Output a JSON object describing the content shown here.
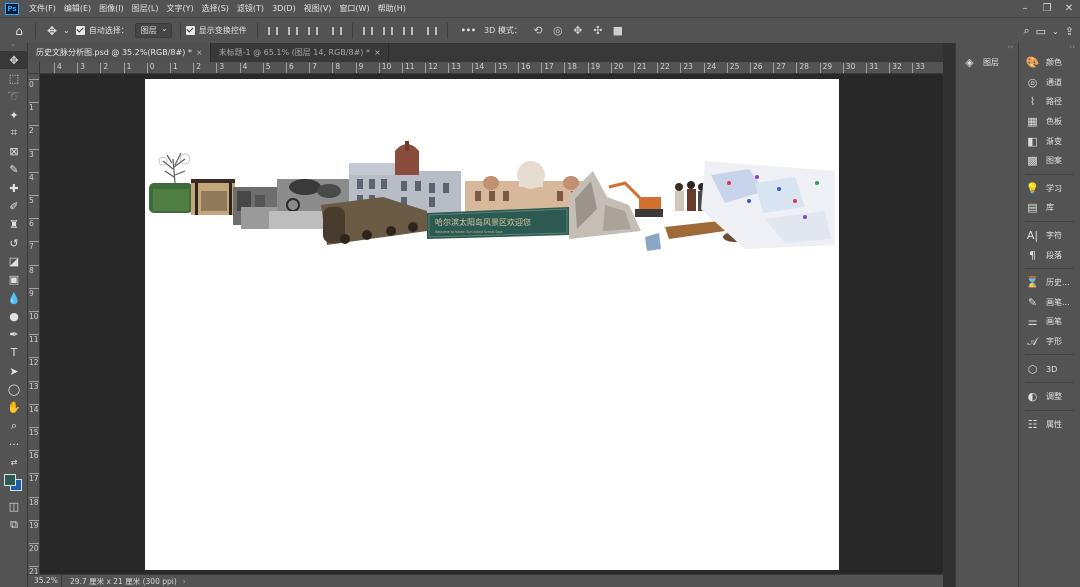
{
  "app": {
    "logo": "Ps",
    "menu": [
      "文件(F)",
      "编辑(E)",
      "图像(I)",
      "图层(L)",
      "文字(Y)",
      "选择(S)",
      "滤镜(T)",
      "3D(D)",
      "视图(V)",
      "窗口(W)",
      "帮助(H)"
    ],
    "window_controls": [
      "minimize-icon",
      "restore-icon",
      "close-icon"
    ]
  },
  "options_bar": {
    "auto_select_label": "自动选择：",
    "auto_select_value": "图层",
    "auto_select_checked": true,
    "transform_label": "显示变换控件",
    "transform_checked": true,
    "more_label": "•••",
    "mode_3d_label": "3D 模式："
  },
  "tabs": [
    {
      "label": "历史文脉分析图.psd @ 35.2%(RGB/8#) *",
      "active": true
    },
    {
      "label": "未标题-1 @ 65.1% (图层 14, RGB/8#) *",
      "active": false
    }
  ],
  "ruler": {
    "h_ticks": [
      "4",
      "3",
      "2",
      "1",
      "0",
      "1",
      "2",
      "3",
      "4",
      "5",
      "6",
      "7",
      "8",
      "9",
      "10",
      "11",
      "12",
      "13",
      "14",
      "15",
      "16",
      "17",
      "18",
      "19",
      "20",
      "21",
      "22",
      "23",
      "24",
      "25",
      "26",
      "27",
      "28",
      "29",
      "30",
      "31",
      "32",
      "33"
    ],
    "v_ticks": [
      "0",
      "1",
      "2",
      "3",
      "4",
      "5",
      "6",
      "7",
      "8",
      "9",
      "10",
      "11",
      "12",
      "13",
      "14",
      "15",
      "16",
      "17",
      "18",
      "19",
      "20",
      "21"
    ]
  },
  "canvas": {
    "banner_text": "哈尔滨太阳岛风景区欢迎您",
    "banner_subtext": "Welcome to Harbin Sun Island Scenic Spot"
  },
  "status": {
    "zoom": "35.2%",
    "doc_size": "29.7 厘米 x 21 厘米 (300 ppi)",
    "arrow": "›"
  },
  "layers_panel": {
    "label": "图层",
    "icon": "layers-icon"
  },
  "panels": [
    {
      "label": "颜色",
      "icon": "color-icon"
    },
    {
      "label": "通道",
      "icon": "channels-icon"
    },
    {
      "label": "路径",
      "icon": "paths-icon"
    },
    {
      "label": "色板",
      "icon": "swatches-icon"
    },
    {
      "label": "渐变",
      "icon": "gradient-icon"
    },
    {
      "label": "图案",
      "icon": "patterns-icon"
    },
    {
      "label": "学习",
      "icon": "learn-icon"
    },
    {
      "label": "库",
      "icon": "libraries-icon"
    },
    {
      "label": "字符",
      "icon": "character-icon"
    },
    {
      "label": "段落",
      "icon": "paragraph-icon"
    },
    {
      "label": "历史...",
      "icon": "history-icon"
    },
    {
      "label": "画笔...",
      "icon": "brush-settings-icon"
    },
    {
      "label": "画笔",
      "icon": "brushes-icon"
    },
    {
      "label": "字形",
      "icon": "glyphs-icon"
    },
    {
      "label": "3D",
      "icon": "3d-icon"
    },
    {
      "label": "调整",
      "icon": "adjustments-icon"
    },
    {
      "label": "属性",
      "icon": "properties-icon"
    }
  ],
  "colors": {
    "foreground": "#2b5956",
    "background": "#1d5ea8"
  }
}
